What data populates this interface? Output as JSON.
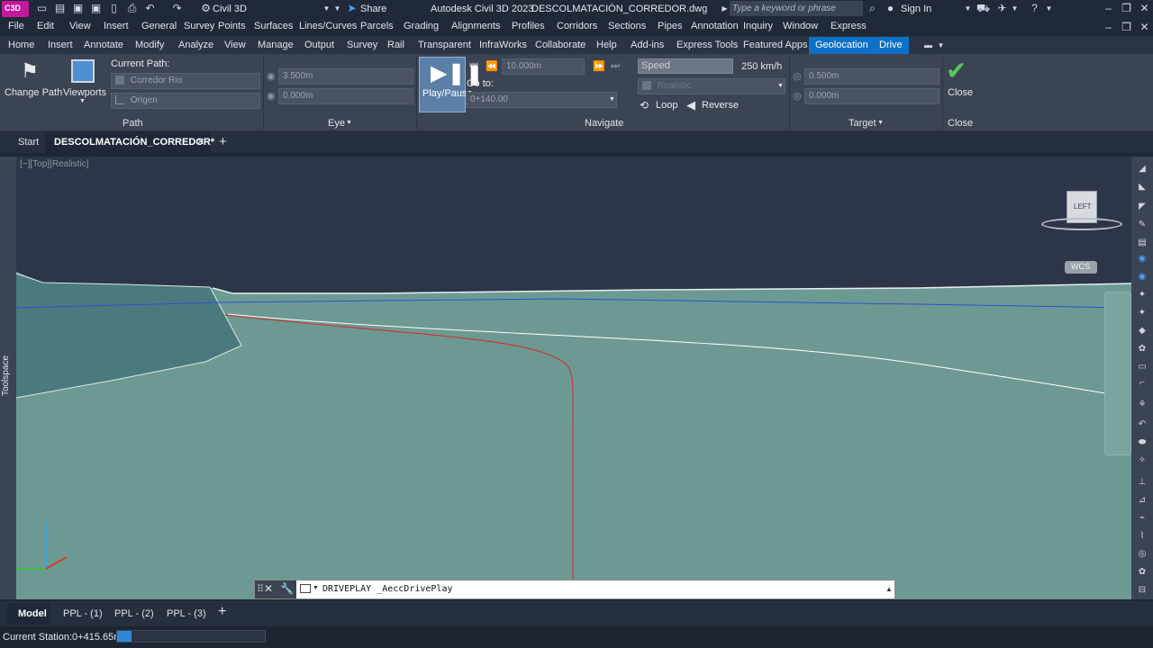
{
  "app": {
    "title": "Autodesk Civil 3D 2023",
    "filename": "DESCOLMATACIÓN_CORREDOR.dwg",
    "workspace": "Civil 3D",
    "share": "Share",
    "search_placeholder": "Type a keyword or phrase",
    "sign_in": "Sign In",
    "logo_text": "C3D"
  },
  "menu": [
    "File",
    "Edit",
    "View",
    "Insert",
    "General",
    "Survey",
    "Points",
    "Surfaces",
    "Lines/Curves",
    "Parcels",
    "Grading",
    "Alignments",
    "Profiles",
    "Corridors",
    "Sections",
    "Pipes",
    "Annotation",
    "Inquiry",
    "Window",
    "Express"
  ],
  "ribbon_tabs": [
    "Home",
    "Insert",
    "Annotate",
    "Modify",
    "Analyze",
    "View",
    "Manage",
    "Output",
    "Survey",
    "Rail",
    "Transparent",
    "InfraWorks",
    "Collaborate",
    "Help",
    "Add-ins",
    "Express Tools",
    "Featured Apps",
    "Geolocation",
    "Drive"
  ],
  "ribbon": {
    "path": {
      "change_path": "Change Path",
      "viewports": "Viewports",
      "current_path_label": "Current Path:",
      "current_path_value": "Corredor Rio",
      "origin": "Origen",
      "panel": "Path"
    },
    "eye": {
      "height": "3.500m",
      "offset": "0.000m",
      "panel": "Eye"
    },
    "navigate": {
      "play_pause": "Play/Pause",
      "step": "10.000m",
      "goto_label": "Go to:",
      "goto_value": "0+140.00",
      "speed_label": "Speed",
      "speed_value": "250 km/h",
      "visual_style": "Realistic",
      "loop": "Loop",
      "reverse": "Reverse",
      "panel": "Navigate"
    },
    "target": {
      "distance": "0.500m",
      "offset": "0.000m",
      "panel": "Target"
    },
    "close": {
      "label": "Close",
      "panel": "Close"
    }
  },
  "doc_tabs": {
    "start": "Start",
    "active": "DESCOLMATACIÓN_CORREDOR*"
  },
  "viewport": {
    "label": "[−][Top][Realistic]",
    "viewcube_face": "LEFT",
    "wcs": "WCS",
    "toolspace": "Toolspace"
  },
  "command": {
    "text": "DRIVEPLAY _AeccDrivePlay"
  },
  "layout_tabs": [
    "Model",
    "PPL - (1)",
    "PPL - (2)",
    "PPL - (3)"
  ],
  "status": {
    "current_station": "Current Station:0+415.65m",
    "progress": 0.1
  }
}
